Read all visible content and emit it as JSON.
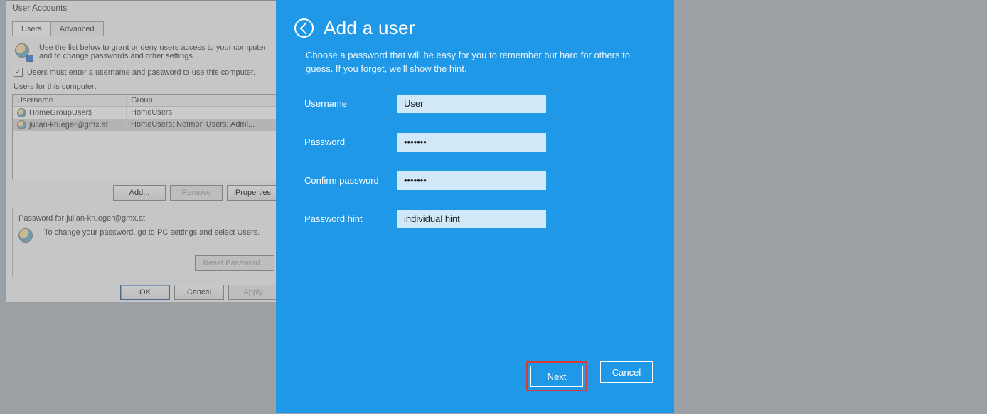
{
  "user_accounts": {
    "title": "User Accounts",
    "tabs": {
      "users": "Users",
      "advanced": "Advanced"
    },
    "instructions": "Use the list below to grant or deny users access to your computer and to change passwords and other settings.",
    "checkbox_label": "Users must enter a username and password to use this computer.",
    "checkbox_checked": true,
    "list_heading": "Users for this computer:",
    "columns": {
      "username": "Username",
      "group": "Group"
    },
    "rows": [
      {
        "username": "HomeGroupUser$",
        "group": "HomeUsers",
        "selected": false
      },
      {
        "username": "julian-krueger@gmx.at",
        "group": "HomeUsers; Netmon Users; Admi...",
        "selected": true
      }
    ],
    "buttons": {
      "add": "Add...",
      "remove": "Remove",
      "properties": "Properties"
    },
    "password_box": {
      "title": "Password for julian-krueger@gmx.at",
      "instruction": "To change your password, go to PC settings and select Users.",
      "reset": "Reset Password..."
    },
    "footer": {
      "ok": "OK",
      "cancel": "Cancel",
      "apply": "Apply"
    }
  },
  "add_user": {
    "title": "Add a user",
    "description": "Choose a password that will be easy for you to remember but hard for others to guess. If you forget, we'll show the hint.",
    "labels": {
      "username": "Username",
      "password": "Password",
      "confirm": "Confirm password",
      "hint": "Password hint"
    },
    "values": {
      "username": "User",
      "password": "•••••••",
      "confirm": "•••••••",
      "hint": "individual hint"
    },
    "buttons": {
      "next": "Next",
      "cancel": "Cancel"
    }
  }
}
